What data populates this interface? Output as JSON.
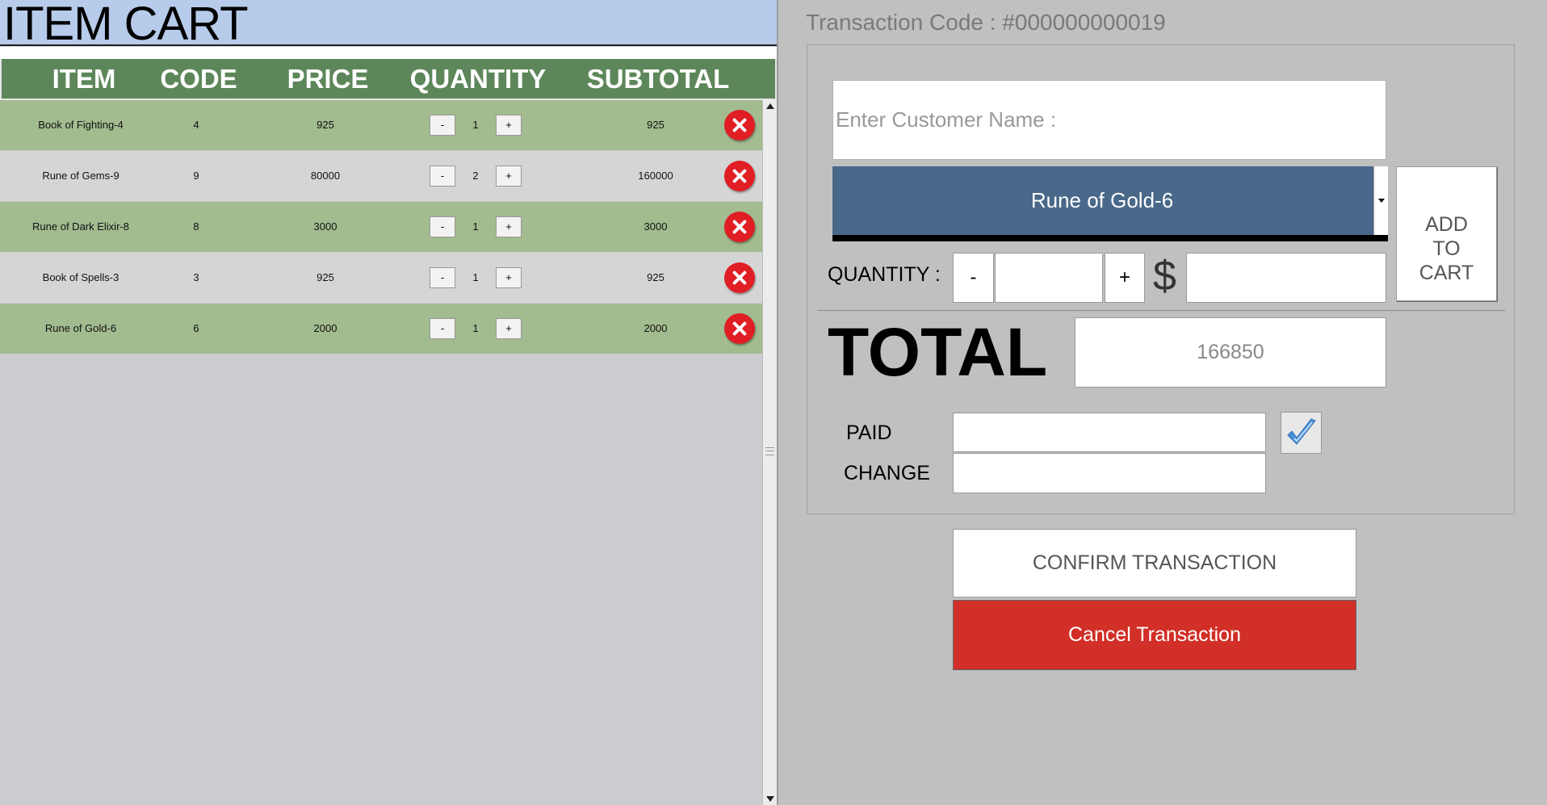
{
  "cart": {
    "title": "ITEM CART",
    "columns": [
      "ITEM",
      "CODE",
      "PRICE",
      "QUANTITY",
      "SUBTOTAL"
    ],
    "minus_label": "-",
    "plus_label": "+",
    "items": [
      {
        "item": "Book of Fighting-4",
        "code": "4",
        "price": "925",
        "quantity": "1",
        "subtotal": "925"
      },
      {
        "item": "Rune of Gems-9",
        "code": "9",
        "price": "80000",
        "quantity": "2",
        "subtotal": "160000"
      },
      {
        "item": "Rune of Dark Elixir-8",
        "code": "8",
        "price": "3000",
        "quantity": "1",
        "subtotal": "3000"
      },
      {
        "item": "Book of Spells-3",
        "code": "3",
        "price": "925",
        "quantity": "1",
        "subtotal": "925"
      },
      {
        "item": "Rune of Gold-6",
        "code": "6",
        "price": "2000",
        "quantity": "1",
        "subtotal": "2000"
      }
    ]
  },
  "transaction": {
    "code_label": "Transaction Code : #000000000019",
    "customer_placeholder": "Enter Customer Name :",
    "selected_item": "Rune of Gold-6",
    "add_to_cart_lines": [
      "ADD",
      "TO",
      "CART"
    ],
    "quantity_label": "QUANTITY :",
    "quantity_minus": "-",
    "quantity_plus": "+",
    "currency_symbol": "$",
    "total_label": "TOTAL",
    "total_value": "166850",
    "paid_label": "PAID",
    "change_label": "CHANGE",
    "confirm_label": "CONFIRM TRANSACTION",
    "cancel_label": "Cancel Transaction"
  },
  "colors": {
    "title_bar": "#b7cbea",
    "header_green": "#5d875a",
    "row_green": "#a2bb8f",
    "row_gray": "#d5d5d5",
    "select_blue": "#49688a",
    "delete_red": "#e01e24",
    "cancel_red": "#d12f27",
    "check_blue": "#4a90d9"
  },
  "icons": {
    "delete": "close-circle-icon",
    "confirm_paid": "checkmark-icon",
    "dropdown": "caret-down-icon"
  }
}
